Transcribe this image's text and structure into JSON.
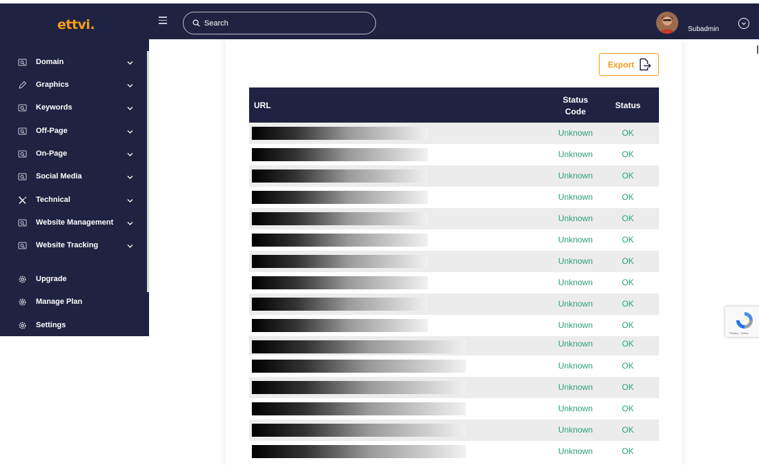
{
  "header": {
    "logo": "ettvi.",
    "search_placeholder": "Search",
    "username": "Subadmin"
  },
  "sidebar": {
    "items": [
      {
        "label": "Domain",
        "icon": "search-doc-icon",
        "expandable": true
      },
      {
        "label": "Graphics",
        "icon": "pen-icon",
        "expandable": true
      },
      {
        "label": "Keywords",
        "icon": "search-doc-icon",
        "expandable": true
      },
      {
        "label": "Off-Page",
        "icon": "search-doc-icon",
        "expandable": true
      },
      {
        "label": "On-Page",
        "icon": "search-doc-icon",
        "expandable": true
      },
      {
        "label": "Social Media",
        "icon": "search-doc-icon",
        "expandable": true
      },
      {
        "label": "Technical",
        "icon": "tools-icon",
        "expandable": true
      },
      {
        "label": "Website Management",
        "icon": "search-doc-icon",
        "expandable": true
      },
      {
        "label": "Website Tracking",
        "icon": "search-doc-icon",
        "expandable": true
      },
      {
        "label": "Upgrade",
        "icon": "gear-icon",
        "expandable": false
      },
      {
        "label": "Manage Plan",
        "icon": "gear-icon",
        "expandable": false
      },
      {
        "label": "Settings",
        "icon": "gear-icon",
        "expandable": false
      }
    ]
  },
  "main": {
    "export_label": "Export",
    "table": {
      "headers": {
        "url": "URL",
        "status_code_line1": "Status",
        "status_code_line2": "Code",
        "status": "Status"
      },
      "rows": [
        {
          "status_code": "Unknown",
          "status": "OK"
        },
        {
          "status_code": "Unknown",
          "status": "OK"
        },
        {
          "status_code": "Unknown",
          "status": "OK"
        },
        {
          "status_code": "Unknown",
          "status": "OK"
        },
        {
          "status_code": "Unknown",
          "status": "OK"
        },
        {
          "status_code": "Unknown",
          "status": "OK"
        },
        {
          "status_code": "Unknown",
          "status": "OK"
        },
        {
          "status_code": "Unknown",
          "status": "OK"
        },
        {
          "status_code": "Unknown",
          "status": "OK"
        },
        {
          "status_code": "Unknown",
          "status": "OK"
        },
        {
          "status_code": "Unknown",
          "status": "OK"
        },
        {
          "status_code": "Unknown",
          "status": "OK"
        },
        {
          "status_code": "Unknown",
          "status": "OK"
        },
        {
          "status_code": "Unknown",
          "status": "OK"
        },
        {
          "status_code": "Unknown",
          "status": "OK"
        },
        {
          "status_code": "Unknown",
          "status": "OK"
        }
      ]
    }
  },
  "recaptcha": {
    "footer": "Privacy - Terms"
  },
  "colors": {
    "navy": "#1f2341",
    "accent": "#f39c12",
    "status_green": "#2aa27a",
    "row_alt": "#ececec"
  }
}
